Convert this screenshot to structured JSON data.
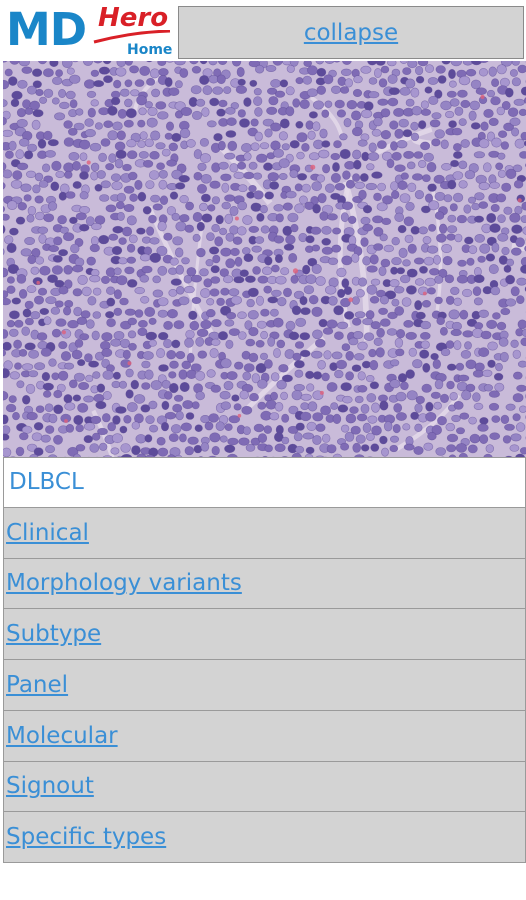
{
  "header": {
    "logo": {
      "md": "MD",
      "hero": "Hero",
      "home": "Home"
    },
    "collapse_label": "collapse"
  },
  "image": {
    "subject": "histology-micrograph"
  },
  "menu": {
    "title": "DLBCL",
    "items": [
      {
        "label": "Clinical"
      },
      {
        "label": "Morphology variants"
      },
      {
        "label": "Subtype"
      },
      {
        "label": "Panel"
      },
      {
        "label": "Molecular"
      },
      {
        "label": "Signout"
      },
      {
        "label": "Specific types"
      }
    ]
  },
  "colors": {
    "link": "#3a8fd6",
    "logo_blue": "#1a86c8",
    "logo_red": "#d92027",
    "row_bg": "#d3d3d3"
  }
}
